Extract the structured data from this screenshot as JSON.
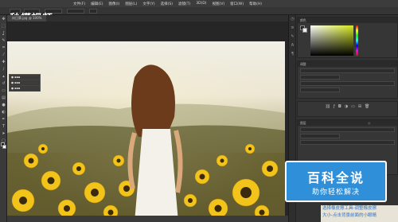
{
  "watermark": {
    "logo_text": "秒懂视频"
  },
  "menu": {
    "items": [
      "文件(F)",
      "编辑(E)",
      "图像(I)",
      "图层(L)",
      "文字(Y)",
      "选择(S)",
      "滤镜(T)",
      "3D(D)",
      "视图(V)",
      "窗口(W)",
      "帮助(H)"
    ]
  },
  "document": {
    "tab_label": "向日葵.jpg @ 100%"
  },
  "panels": {
    "color_title": "颜色",
    "adjust_title": "调整",
    "layers_title": "图层"
  },
  "baike": {
    "title": "百科全说",
    "subtitle": "助你轻松解决"
  },
  "caption": {
    "line1": "选择橡皮擦工具-调整橡皮擦",
    "line2": "大小-点击背景前面的小眼睛"
  },
  "colors": {
    "accent": "#2f8fd8",
    "canvas_bg": "#262626",
    "panel_bg": "#363636"
  }
}
